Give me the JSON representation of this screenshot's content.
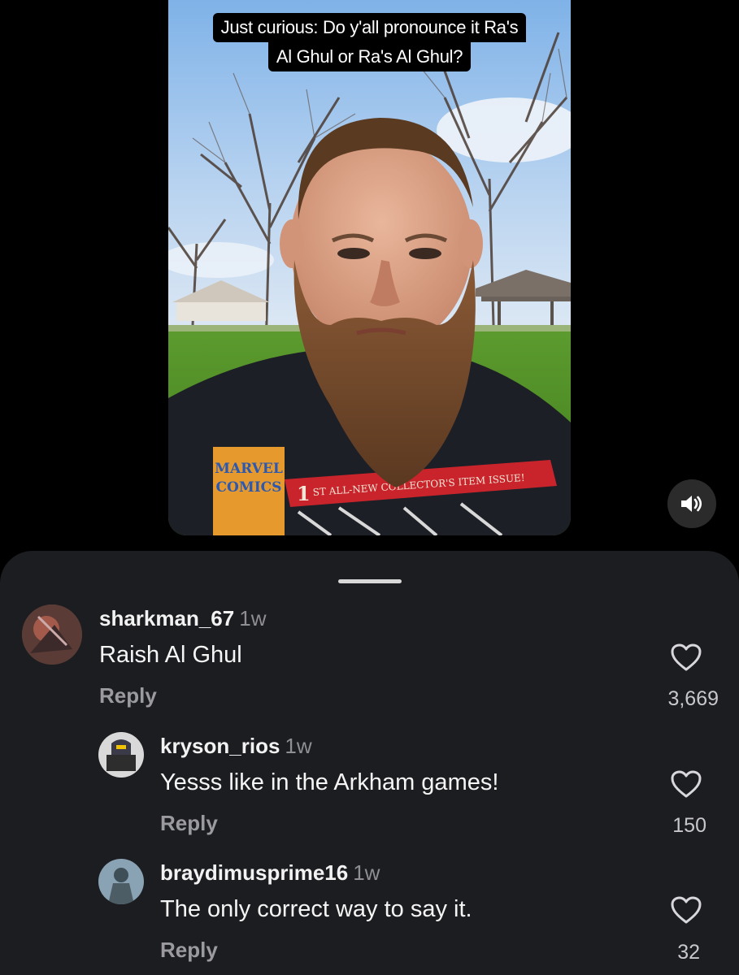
{
  "video": {
    "caption_line1": "Just curious: Do y'all pronounce it Ra's",
    "caption_line2": "Al Ghul or Ra's Al Ghul?",
    "shirt_logo_line1": "MARVEL",
    "shirt_logo_line2": "COMICS",
    "shirt_banner_number": "1",
    "shirt_banner": "ST ALL-NEW COLLECTOR'S ITEM ISSUE!"
  },
  "controls": {
    "volume_icon": "speaker-on-icon"
  },
  "comments": [
    {
      "username": "sharkman_67",
      "age": "1w",
      "text": "Raish Al Ghul",
      "reply": "Reply",
      "likes": "3,669"
    },
    {
      "username": "kryson_rios",
      "age": "1w",
      "text": "Yesss like in the Arkham games!",
      "reply": "Reply",
      "likes": "150"
    },
    {
      "username": "braydimusprime16",
      "age": "1w",
      "text": "The only correct way to say it.",
      "reply": "Reply",
      "likes": "32"
    }
  ],
  "colors": {
    "sheet_background": "#1c1d20",
    "secondary_text": "#8e8e93",
    "page_background": "#000000"
  }
}
